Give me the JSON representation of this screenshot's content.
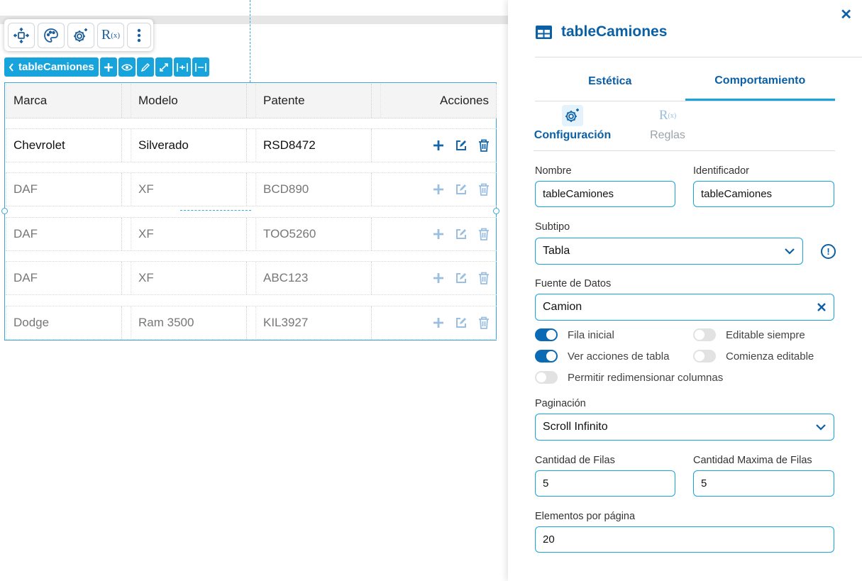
{
  "toolbar": {
    "icons": [
      "move-icon",
      "palette-icon",
      "settings-icon",
      "rules-icon",
      "more-icon"
    ],
    "rules_label": "R",
    "rules_sub": "(x)"
  },
  "component_tag": {
    "name": "tableCamiones",
    "buttons": [
      "add-icon",
      "eye-icon",
      "pencil-icon",
      "expand-icon",
      "expand-columns-icon",
      "shrink-columns-icon"
    ]
  },
  "table": {
    "columns": [
      "Marca",
      "Modelo",
      "Patente",
      "Acciones"
    ],
    "rows": [
      {
        "marca": "Chevrolet",
        "modelo": "Silverado",
        "patente": "RSD8472"
      },
      {
        "marca": "DAF",
        "modelo": "XF",
        "patente": "BCD890"
      },
      {
        "marca": "DAF",
        "modelo": "XF",
        "patente": "TOO5260"
      },
      {
        "marca": "DAF",
        "modelo": "XF",
        "patente": "ABC123"
      },
      {
        "marca": "Dodge",
        "modelo": "Ram 3500",
        "patente": "KIL3927"
      }
    ]
  },
  "panel": {
    "title": "tableCamiones",
    "tabs": [
      {
        "label": "Estética",
        "active": false
      },
      {
        "label": "Comportamiento",
        "active": true
      }
    ],
    "subtabs": [
      {
        "label": "Configuración",
        "active": true
      },
      {
        "label": "Reglas",
        "active": false
      }
    ],
    "fields": {
      "nombre_label": "Nombre",
      "nombre_value": "tableCamiones",
      "identificador_label": "Identificador",
      "identificador_value": "tableCamiones",
      "subtipo_label": "Subtipo",
      "subtipo_value": "Tabla",
      "fuente_label": "Fuente de Datos",
      "fuente_value": "Camion",
      "paginacion_label": "Paginación",
      "paginacion_value": "Scroll Infinito",
      "cantidad_filas_label": "Cantidad de Filas",
      "cantidad_filas_value": "5",
      "cantidad_max_label": "Cantidad Maxima de Filas",
      "cantidad_max_value": "5",
      "elementos_label": "Elementos por página",
      "elementos_value": "20"
    },
    "toggles": [
      {
        "label": "Fila inicial",
        "on": true
      },
      {
        "label": "Editable siempre",
        "on": false
      },
      {
        "label": "Ver acciones de tabla",
        "on": true
      },
      {
        "label": "Comienza editable",
        "on": false
      },
      {
        "label": "Permitir redimensionar columnas",
        "on": false
      }
    ],
    "info_icon_glyph": "!"
  },
  "colors": {
    "accent": "#17a3dc",
    "primary": "#0b5fa5",
    "toggle_on": "#0b6ab4"
  }
}
